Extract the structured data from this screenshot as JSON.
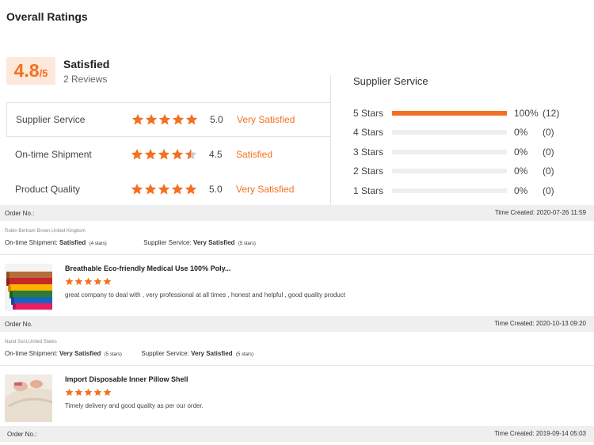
{
  "title": "Overall Ratings",
  "summary": {
    "score": "4.8",
    "scale": "/5",
    "label": "Satisfied",
    "reviews": "2 Reviews"
  },
  "colors": {
    "accent": "#f37021",
    "accent_bg": "#fde8d9",
    "empty_star": "#c8c8c8",
    "bar_bg": "#eeeeee"
  },
  "ratings": [
    {
      "label": "Supplier Service",
      "score": "5.0",
      "stars": 5.0,
      "desc": "Very Satisfied"
    },
    {
      "label": "On-time Shipment",
      "score": "4.5",
      "stars": 4.5,
      "desc": "Satisfied"
    },
    {
      "label": "Product Quality",
      "score": "5.0",
      "stars": 5.0,
      "desc": "Very Satisfied"
    }
  ],
  "histogram": {
    "title": "Supplier Service",
    "rows": [
      {
        "label": "5  Stars",
        "fraction": 1.0,
        "pct": "100%",
        "count": "(12)"
      },
      {
        "label": "4  Stars",
        "fraction": 0,
        "pct": "0%",
        "count": "(0)"
      },
      {
        "label": "3  Stars",
        "fraction": 0,
        "pct": "0%",
        "count": "(0)"
      },
      {
        "label": "2  Stars",
        "fraction": 0,
        "pct": "0%",
        "count": "(0)"
      },
      {
        "label": "1  Stars",
        "fraction": 0,
        "pct": "0%",
        "count": "(0)"
      }
    ]
  },
  "orders": [
    {
      "order_label": "Order No.:",
      "time": "Time Created: 2020-07-26 11:59",
      "reviewer": "Robin Bertram Brown,United Kingdom",
      "shipment_label": "On-time Shipment:",
      "shipment_value": "Satisfied",
      "shipment_stars": "(4 stars)",
      "service_label": "Supplier Service:",
      "service_value": "Very Satisfied",
      "service_stars": "(5 stars)",
      "product_title": "Breathable Eco-friendly Medical Use 100% Poly...",
      "product_stars": 5,
      "comment": "great company to deal with , very professional at all times , honest and helpful , good quality product",
      "thumb_icon": "fabric-rolls-image"
    },
    {
      "order_label": "Order No.",
      "time": "Time Created: 2020-10-13 09:20",
      "reviewer": "Nand Soni,United States",
      "shipment_label": "On-time Shipment:",
      "shipment_value": "Very Satisfied",
      "shipment_stars": "(5 stars)",
      "service_label": "Supplier Service:",
      "service_value": "Very Satisfied",
      "service_stars": "(5 stars)",
      "product_title": "Import Disposable Inner Pillow Shell",
      "product_stars": 5,
      "comment": "Timely delivery and good quality as per our order.",
      "thumb_icon": "pillow-image"
    },
    {
      "order_label": "Order No.:",
      "time": "Time Created: 2019-09-14 05:03"
    }
  ]
}
